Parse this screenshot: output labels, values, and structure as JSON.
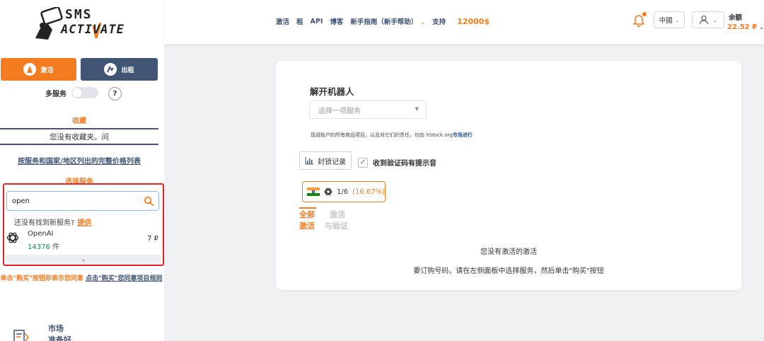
{
  "logo": {
    "line1": "SMS",
    "line2": "ACTIVATE"
  },
  "sidebar": {
    "activate_label": "激活",
    "rent_label": "出租",
    "multi_service_label": "多服务",
    "help_label": "?",
    "favorites_title": "收藏",
    "favorites_empty": "您没有收藏夹。问",
    "price_list_link": "按服务和国家/地区列出的完整价格列表",
    "select_service_title": "选择服务",
    "search": {
      "value": "open",
      "placeholder": ""
    },
    "not_found_text": "还没有找到新服务?",
    "not_found_link": "提供",
    "services": [
      {
        "name": "OpenAI",
        "count": "14376",
        "unit": "件",
        "price": "7 ₽"
      }
    ],
    "expand_icon": "⌄",
    "agreement_text": "单击\"购买\"按钮即表示您同意",
    "agreement_link": "点击\"购买\"您同意项目规则",
    "market_line1": "市场",
    "market_line2": "准备好"
  },
  "header": {
    "nav": [
      "激活",
      "租",
      "API",
      "博客"
    ],
    "guide_label": "新手指南（新手帮助）",
    "support_label": "支持",
    "top_balance": "12000$",
    "language": "中國",
    "balance_label": "余额",
    "balance_value": "22.52 ₽"
  },
  "main": {
    "title": "解开机器人",
    "service_select_placeholder": "选择一项服务",
    "disclaimer_text": "现成账户的所有商品项目，以及对它们的责任，均由 hStock.org",
    "disclaimer_link": "市场进行",
    "blocklog_label": "封锁记录",
    "sound_checkbox_label": "收到验证码有提示音",
    "sound_checked": true,
    "stat_count": "1/6",
    "stat_percent": "(16.67%)",
    "tab_all_1": "全部",
    "tab_all_2": "激活",
    "tab_verify_1": "激活",
    "tab_verify_2": "与验证",
    "empty_title": "您没有激活的激活",
    "empty_desc": "要订购号码，请在左侧面板中选择服务，然后单击\"购买\"按钮"
  },
  "colors": {
    "accent": "#f47b20",
    "navy": "#3f5573",
    "success": "#1a8a4c",
    "highlight": "#e0262b"
  }
}
